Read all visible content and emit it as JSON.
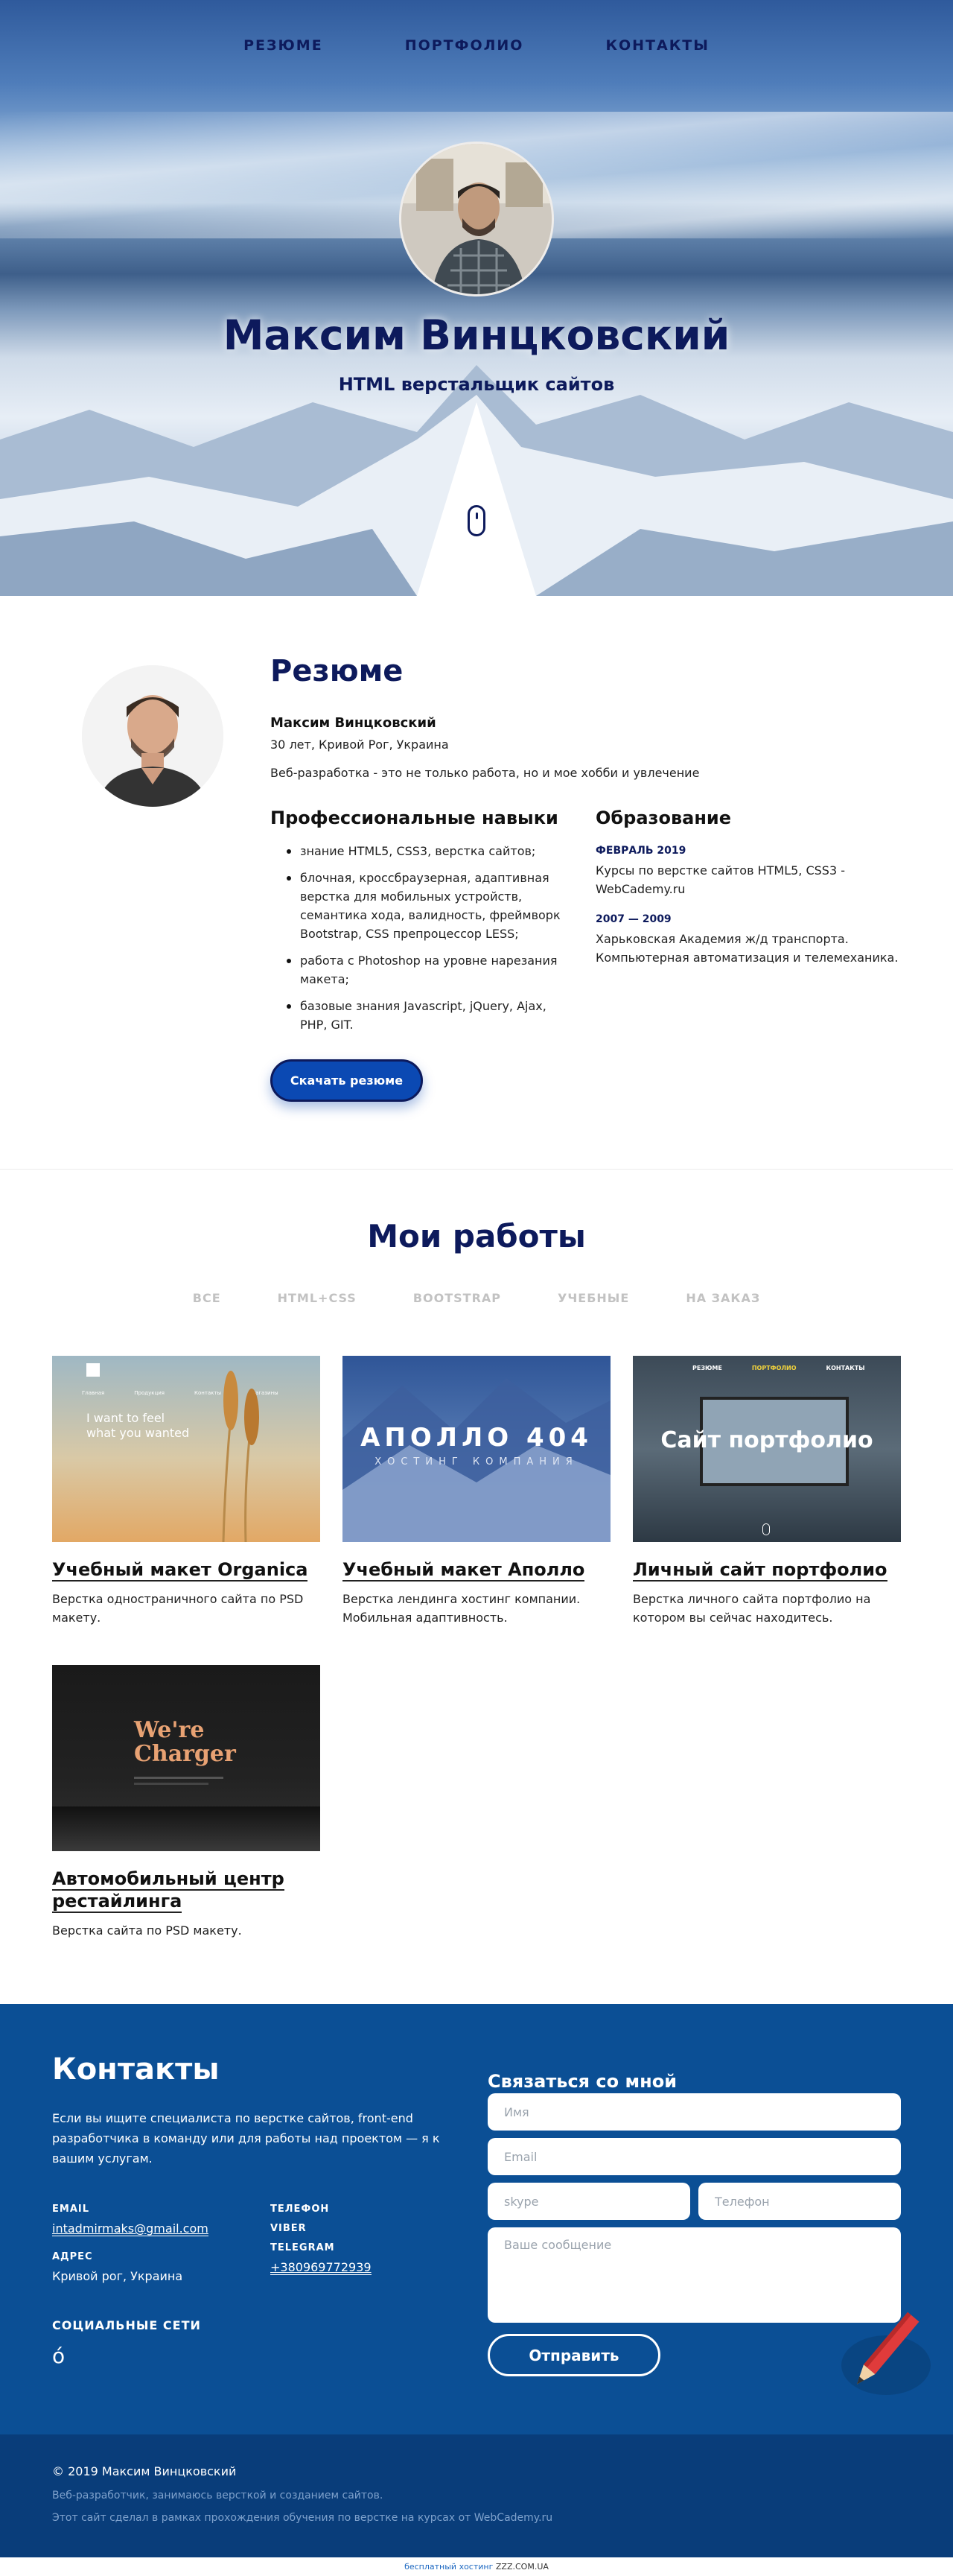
{
  "nav": {
    "items": [
      "РЕЗЮМЕ",
      "ПОРТФОЛИО",
      "КОНТАКТЫ"
    ]
  },
  "hero": {
    "name": "Максим Винцковский",
    "subtitle": "HTML верстальщик сайтов"
  },
  "resume": {
    "title": "Резюме",
    "name": "Максим Винцковский",
    "meta": "30 лет, Кривой Рог, Украина",
    "about": "Веб-разработка - это не только работа, но и мое хобби и увлечение",
    "skills_title": "Профессиональные навыки",
    "skills": [
      "знание HTML5, CSS3, верстка сайтов;",
      "блочная, кроссбраузерная, адаптивная верстка для мобильных устройств, семантика хода, валидность, фреймворк Bootstrap, CSS препроцессор LESS;",
      "работа с Photoshop на уровне нарезания макета;",
      "базовые знания Javascript, jQuery, Ajax, PHP, GIT."
    ],
    "education_title": "Образование",
    "education": [
      {
        "date": "ФЕВРАЛЬ 2019",
        "text": "Курсы по верстке сайтов HTML5, CSS3 - WebCademy.ru"
      },
      {
        "date": "2007 — 2009",
        "text": "Харьковская Академия ж/д транспорта. Компьютерная автоматизация и телемеханика."
      }
    ],
    "download_label": "Скачать резюме"
  },
  "portfolio": {
    "title": "Мои работы",
    "filters": [
      "ВСЕ",
      "HTML+CSS",
      "BOOTSTRAP",
      "УЧЕБНЫЕ",
      "НА ЗАКАЗ"
    ],
    "cards": [
      {
        "title": "Учебный макет Organica",
        "desc": "Верстка одностраничного сайта по PSD макету.",
        "thumb_text": "I want to feel what you wanted",
        "thumb_nav": [
          "Главная",
          "Продукция",
          "Контакты",
          "Магазины"
        ]
      },
      {
        "title": "Учебный макет Аполло",
        "desc": "Верстка лендинга хостинг компании. Мобильная адаптивность.",
        "thumb_text": "АПОЛЛО 404",
        "thumb_sub": "ХОСТИНГ КОМПАНИЯ"
      },
      {
        "title": "Личный сайт портфолио",
        "desc": "Верстка личного сайта портфолио на котором вы сейчас находитесь.",
        "thumb_text": "Сайт портфолио",
        "thumb_nav": [
          "РЕЗЮМЕ",
          "ПОРТФОЛИО",
          "КОНТАКТЫ"
        ]
      },
      {
        "title": "Автомобильный центр рестайлинга",
        "desc": "Верстка сайта по PSD макету.",
        "thumb_text": "We're Charger"
      }
    ]
  },
  "contacts": {
    "title": "Контакты",
    "text": "Если вы ищите специалиста по верстке сайтов, front-end разработчика в команду или для работы над проектом — я к вашим услугам.",
    "email_label": "EMAIL",
    "email_value": "intadmirmaks@gmail.com",
    "address_label": "АДРЕС",
    "address_value": "Кривой рог, Украина",
    "phone_label": "ТЕЛЕФОН",
    "viber_label": "VIBER",
    "telegram_label": "TELEGRAM",
    "phone_value": "+380969772939",
    "social_title": "СОЦИАЛЬНЫЕ СЕТИ",
    "social_icon": "ó",
    "form_title": "Связаться со мной",
    "placeholders": {
      "name": "Имя",
      "email": "Email",
      "skype": "skype",
      "phone": "Телефон",
      "message": "Ваше сообщение"
    },
    "send_label": "Отправить"
  },
  "footer": {
    "copyright": "© 2019 Максим Винцковский",
    "line1": "Веб-разработчик, занимаюсь версткой и созданием сайтов.",
    "line2_prefix": "Этот сайт сделал в рамках прохождения обучения по верстке на курсах от ",
    "line2_link": "WebCademy.ru",
    "host_prefix": "бесплатный хостинг ",
    "host_link": "ZZZ.COM.UA"
  },
  "colors": {
    "brand_dark": "#0d1a5c",
    "button_blue": "#0b49b3",
    "contacts_bg": "#0b4f95",
    "footer_bg": "#093d7a"
  }
}
